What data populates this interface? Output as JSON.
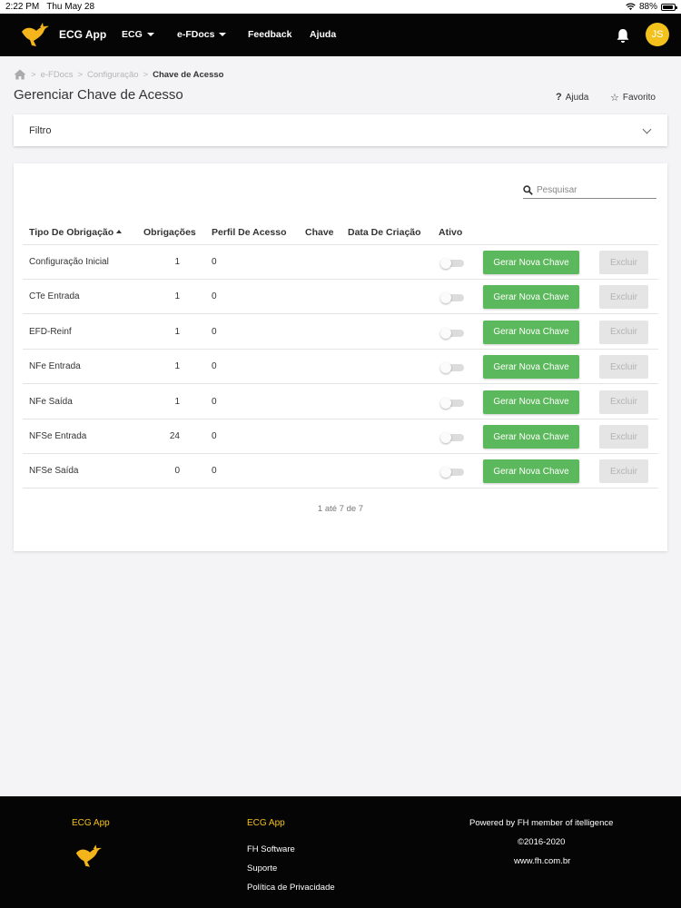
{
  "status_bar": {
    "time": "2:22 PM",
    "date": "Thu May 28",
    "battery": "88%",
    "battery_level": 0.88
  },
  "nav": {
    "app_title": "ECG App",
    "items": [
      {
        "label": "ECG",
        "dropdown": true
      },
      {
        "label": "e-FDocs",
        "dropdown": true
      },
      {
        "label": "Feedback",
        "dropdown": false
      },
      {
        "label": "Ajuda",
        "dropdown": false
      }
    ],
    "avatar_initials": "JS",
    "bell_icon": "bell-icon"
  },
  "breadcrumb": {
    "home_icon": "home-icon",
    "items": [
      "e-FDocs",
      "Configuração"
    ],
    "current": "Chave de Acesso",
    "separator": ">"
  },
  "page": {
    "title": "Gerenciar Chave de Acesso",
    "help_icon": "?",
    "help_label": "Ajuda",
    "favorite_icon": "☆",
    "favorite_label": "Favorito"
  },
  "filter": {
    "label": "Filtro"
  },
  "search": {
    "placeholder": "Pesquisar",
    "value": ""
  },
  "table": {
    "columns": [
      "Tipo De Obrigação",
      "Obrigações",
      "Perfil De Acesso",
      "Chave",
      "Data De Criação",
      "Ativo"
    ],
    "rows": [
      {
        "tipo": "Configuração Inicial",
        "obrigacoes": "1",
        "perfil": "0",
        "chave": "",
        "data": "",
        "ativo": false
      },
      {
        "tipo": "CTe Entrada",
        "obrigacoes": "1",
        "perfil": "0",
        "chave": "",
        "data": "",
        "ativo": false
      },
      {
        "tipo": "EFD-Reinf",
        "obrigacoes": "1",
        "perfil": "0",
        "chave": "",
        "data": "",
        "ativo": false
      },
      {
        "tipo": "NFe Entrada",
        "obrigacoes": "1",
        "perfil": "0",
        "chave": "",
        "data": "",
        "ativo": false
      },
      {
        "tipo": "NFe Saída",
        "obrigacoes": "1",
        "perfil": "0",
        "chave": "",
        "data": "",
        "ativo": false
      },
      {
        "tipo": "NFSe Entrada",
        "obrigacoes": "24",
        "perfil": "0",
        "chave": "",
        "data": "",
        "ativo": false
      },
      {
        "tipo": "NFSe Saída",
        "obrigacoes": "0",
        "perfil": "0",
        "chave": "",
        "data": "",
        "ativo": false
      }
    ],
    "generate_label": "Gerar Nova Chave",
    "delete_label": "Excluir",
    "pagination": "1 até 7 de 7"
  },
  "footer": {
    "left_title": "ECG App",
    "middle_title": "ECG App",
    "links": [
      "FH Software",
      "Suporte",
      "Política de Privacidade"
    ],
    "powered": "Powered by FH member of itelligence",
    "copyright": "©2016-2020",
    "website": "www.fh.com.br"
  },
  "colors": {
    "accent": "#f3c11b",
    "success": "#5cb85c",
    "nav_bg": "#050505"
  }
}
